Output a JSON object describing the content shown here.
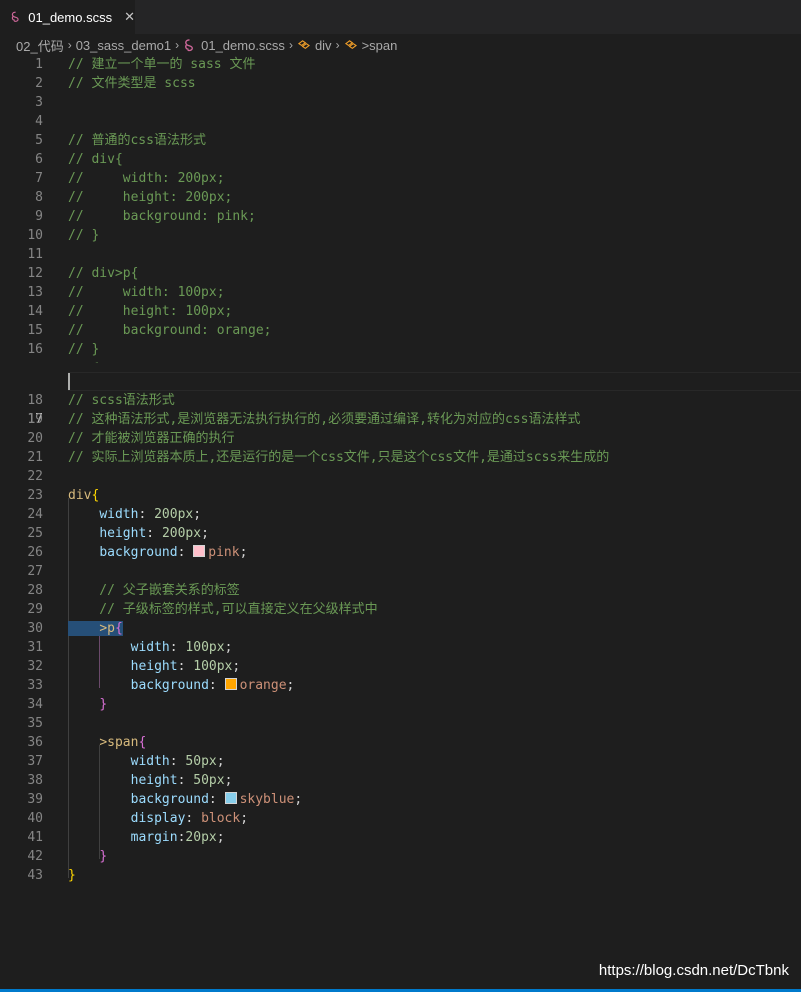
{
  "tab": {
    "title": "01_demo.scss",
    "close": "✕"
  },
  "breadcrumb": {
    "items": [
      "02_代码",
      "03_sass_demo1",
      "01_demo.scss",
      "div",
      ">span"
    ],
    "separator": "›"
  },
  "code_lines": [
    "// 建立一个单一的 sass 文件",
    "// 文件类型是 scss",
    "",
    "",
    "// 普通的css语法形式",
    "// div{",
    "//     width: 200px;",
    "//     height: 200px;",
    "//     background: pink;",
    "// }",
    "",
    "// div>p{",
    "//     width: 100px;",
    "//     height: 100px;",
    "//     background: orange;",
    "// }",
    "",
    "// scss语法形式",
    "// 这种语法形式,是浏览器无法执行执行的,必须要通过编译,转化为对应的css语法样式",
    "// 才能被浏览器正确的执行",
    "// 实际上浏览器本质上,还是运行的是一个css文件,只是这个css文件,是通过scss来生成的",
    "",
    "div{",
    "    width: 200px;",
    "    height: 200px;",
    "    background: pink;",
    "",
    "    // 父子嵌套关系的标签",
    "    // 子级标签的样式,可以直接定义在父级样式中",
    "    >p{",
    "        width: 100px;",
    "        height: 100px;",
    "        background: orange;",
    "    }",
    "",
    "    >span{",
    "        width: 50px;",
    "        height: 50px;",
    "        background: skyblue;",
    "        display: block;",
    "        margin:20px;",
    "    }",
    "}"
  ],
  "colors": {
    "pink": "#ffc0cb",
    "orange": "#ffa500",
    "skyblue": "#87ceeb",
    "background": "#1e1e1e",
    "comment": "#6a9955",
    "accent": "#007acc"
  },
  "icons": {
    "file": "sass-icon",
    "symbol": "symbol-class-icon",
    "close": "close-icon"
  },
  "watermark": "https://blog.csdn.net/DcTbnk"
}
